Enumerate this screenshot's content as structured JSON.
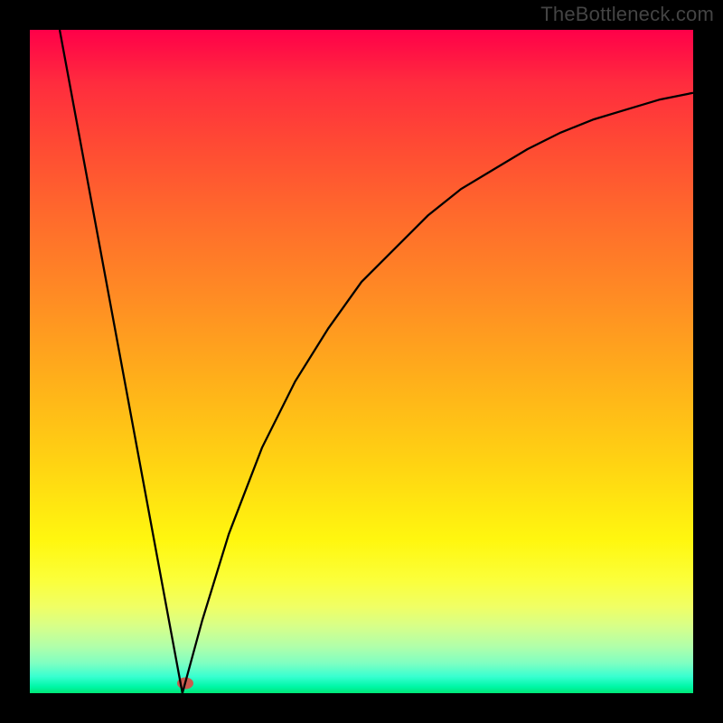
{
  "watermark": "TheBottleneck.com",
  "colors": {
    "page_bg": "#000000",
    "watermark": "#444444",
    "curve_stroke": "#000000",
    "marker_fill": "#c95b4f",
    "gradient_top": "#ff0049",
    "gradient_bottom": "#00e676"
  },
  "chart_data": {
    "type": "line",
    "title": "",
    "xlabel": "",
    "ylabel": "",
    "xlim": [
      0,
      100
    ],
    "ylim": [
      0,
      100
    ],
    "grid": false,
    "annotations": [],
    "series": [
      {
        "name": "left-segment",
        "x": [
          4.5,
          23
        ],
        "y": [
          100,
          0
        ]
      },
      {
        "name": "right-segment",
        "x": [
          23,
          26,
          30,
          35,
          40,
          45,
          50,
          55,
          60,
          65,
          70,
          75,
          80,
          85,
          90,
          95,
          100
        ],
        "y": [
          0,
          11,
          24,
          37,
          47,
          55,
          62,
          67,
          72,
          76,
          79,
          82,
          84.5,
          86.5,
          88,
          89.5,
          90.5
        ]
      }
    ],
    "marker": {
      "x": 23.5,
      "y": 1.5
    },
    "background_gradient_meaning": "vertical spectrum red(top)->green(bottom) indicating value scale"
  }
}
